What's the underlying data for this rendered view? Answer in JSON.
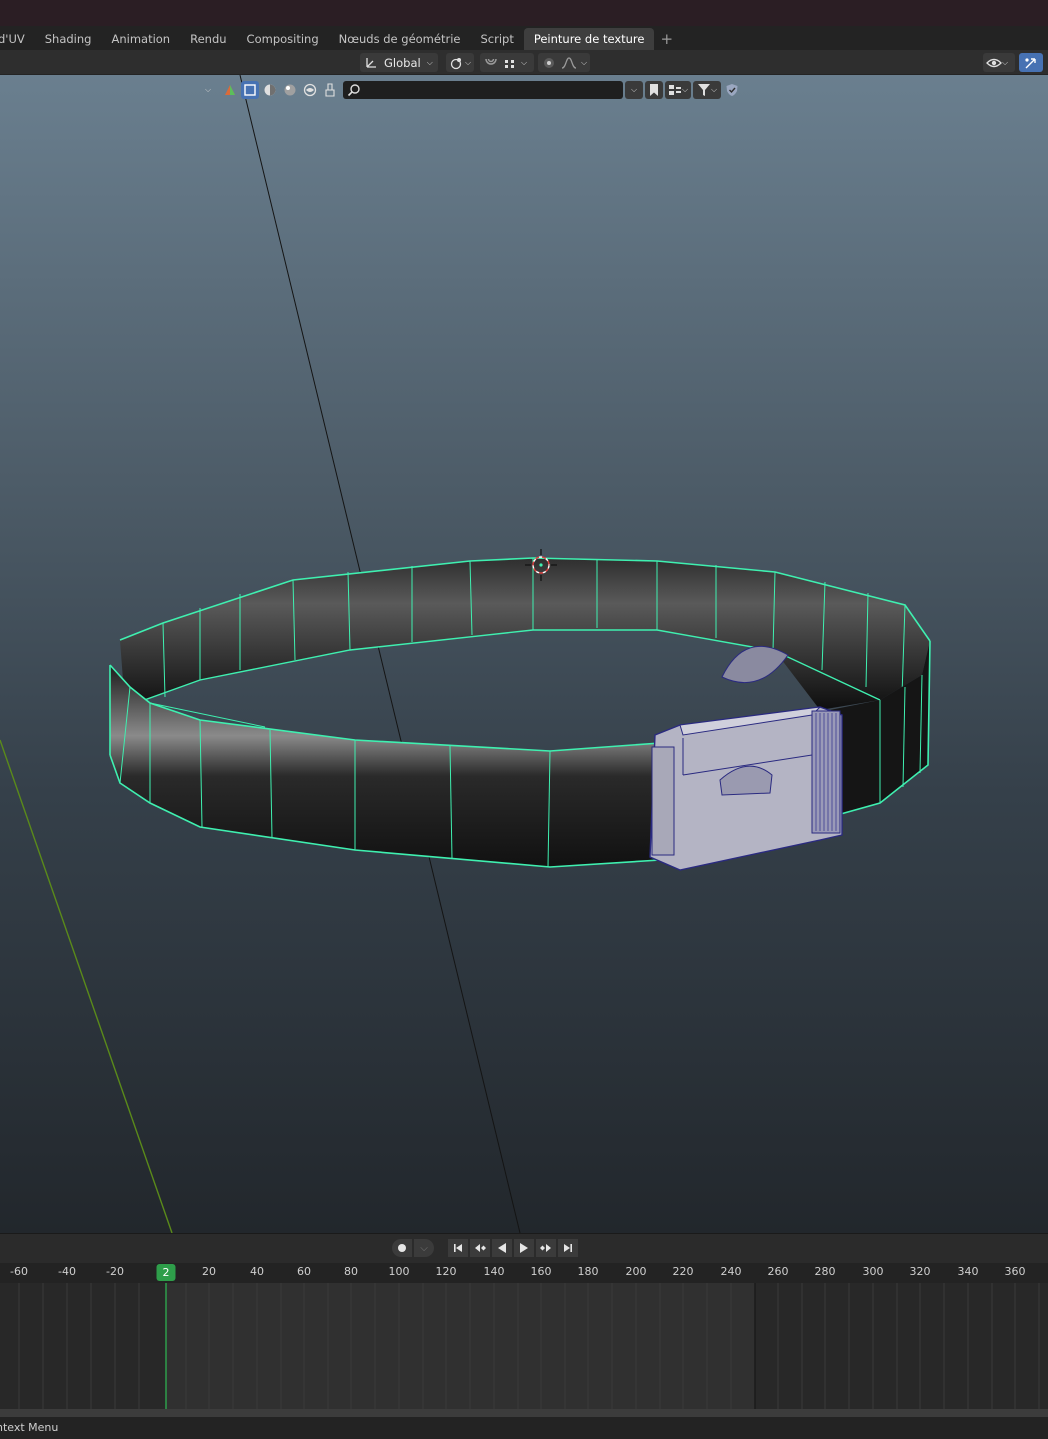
{
  "workspace_tabs": [
    {
      "label": "d'UV"
    },
    {
      "label": "Shading"
    },
    {
      "label": "Animation"
    },
    {
      "label": "Rendu"
    },
    {
      "label": "Compositing"
    },
    {
      "label": "Nœuds de géométrie"
    },
    {
      "label": "Script"
    },
    {
      "label": "Peinture de texture"
    }
  ],
  "active_tab": "Peinture de texture",
  "add_tab_symbol": "+",
  "header": {
    "orientation_value": "Global"
  },
  "outliner_search": {
    "placeholder": "",
    "value": ""
  },
  "timeline": {
    "current_frame": "2",
    "ticks": [
      "-60",
      "-40",
      "-20",
      "2",
      "20",
      "40",
      "60",
      "80",
      "100",
      "120",
      "140",
      "160",
      "180",
      "200",
      "220",
      "240",
      "260",
      "280",
      "300",
      "320",
      "340",
      "360"
    ]
  },
  "status": {
    "context_menu": "ntext Menu"
  },
  "colors": {
    "accent": "#4772b3",
    "selection_outline": "#3ff0b0",
    "current_frame": "#2e9e4a",
    "active_tab": "#3e3e3e"
  }
}
